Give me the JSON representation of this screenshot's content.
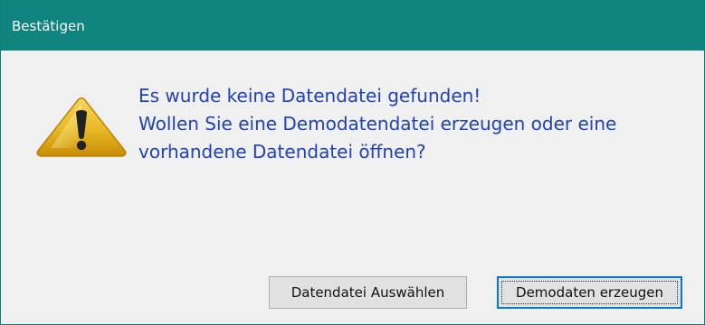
{
  "window": {
    "title": "Bestätigen"
  },
  "dialog": {
    "icon": "warning-icon",
    "message_lines": [
      "Es wurde keine Datendatei gefunden!",
      "Wollen Sie eine Demodatendatei erzeugen oder eine",
      "vorhandene Datendatei öffnen?"
    ],
    "buttons": {
      "choose_data_file": "Datendatei Auswählen",
      "create_demo_data": "Demodaten erzeugen"
    }
  },
  "colors": {
    "titlebar": "#0f837e",
    "message_text": "#2042b8",
    "warning_fill": "#e9b823",
    "focus_border": "#0078d7"
  }
}
